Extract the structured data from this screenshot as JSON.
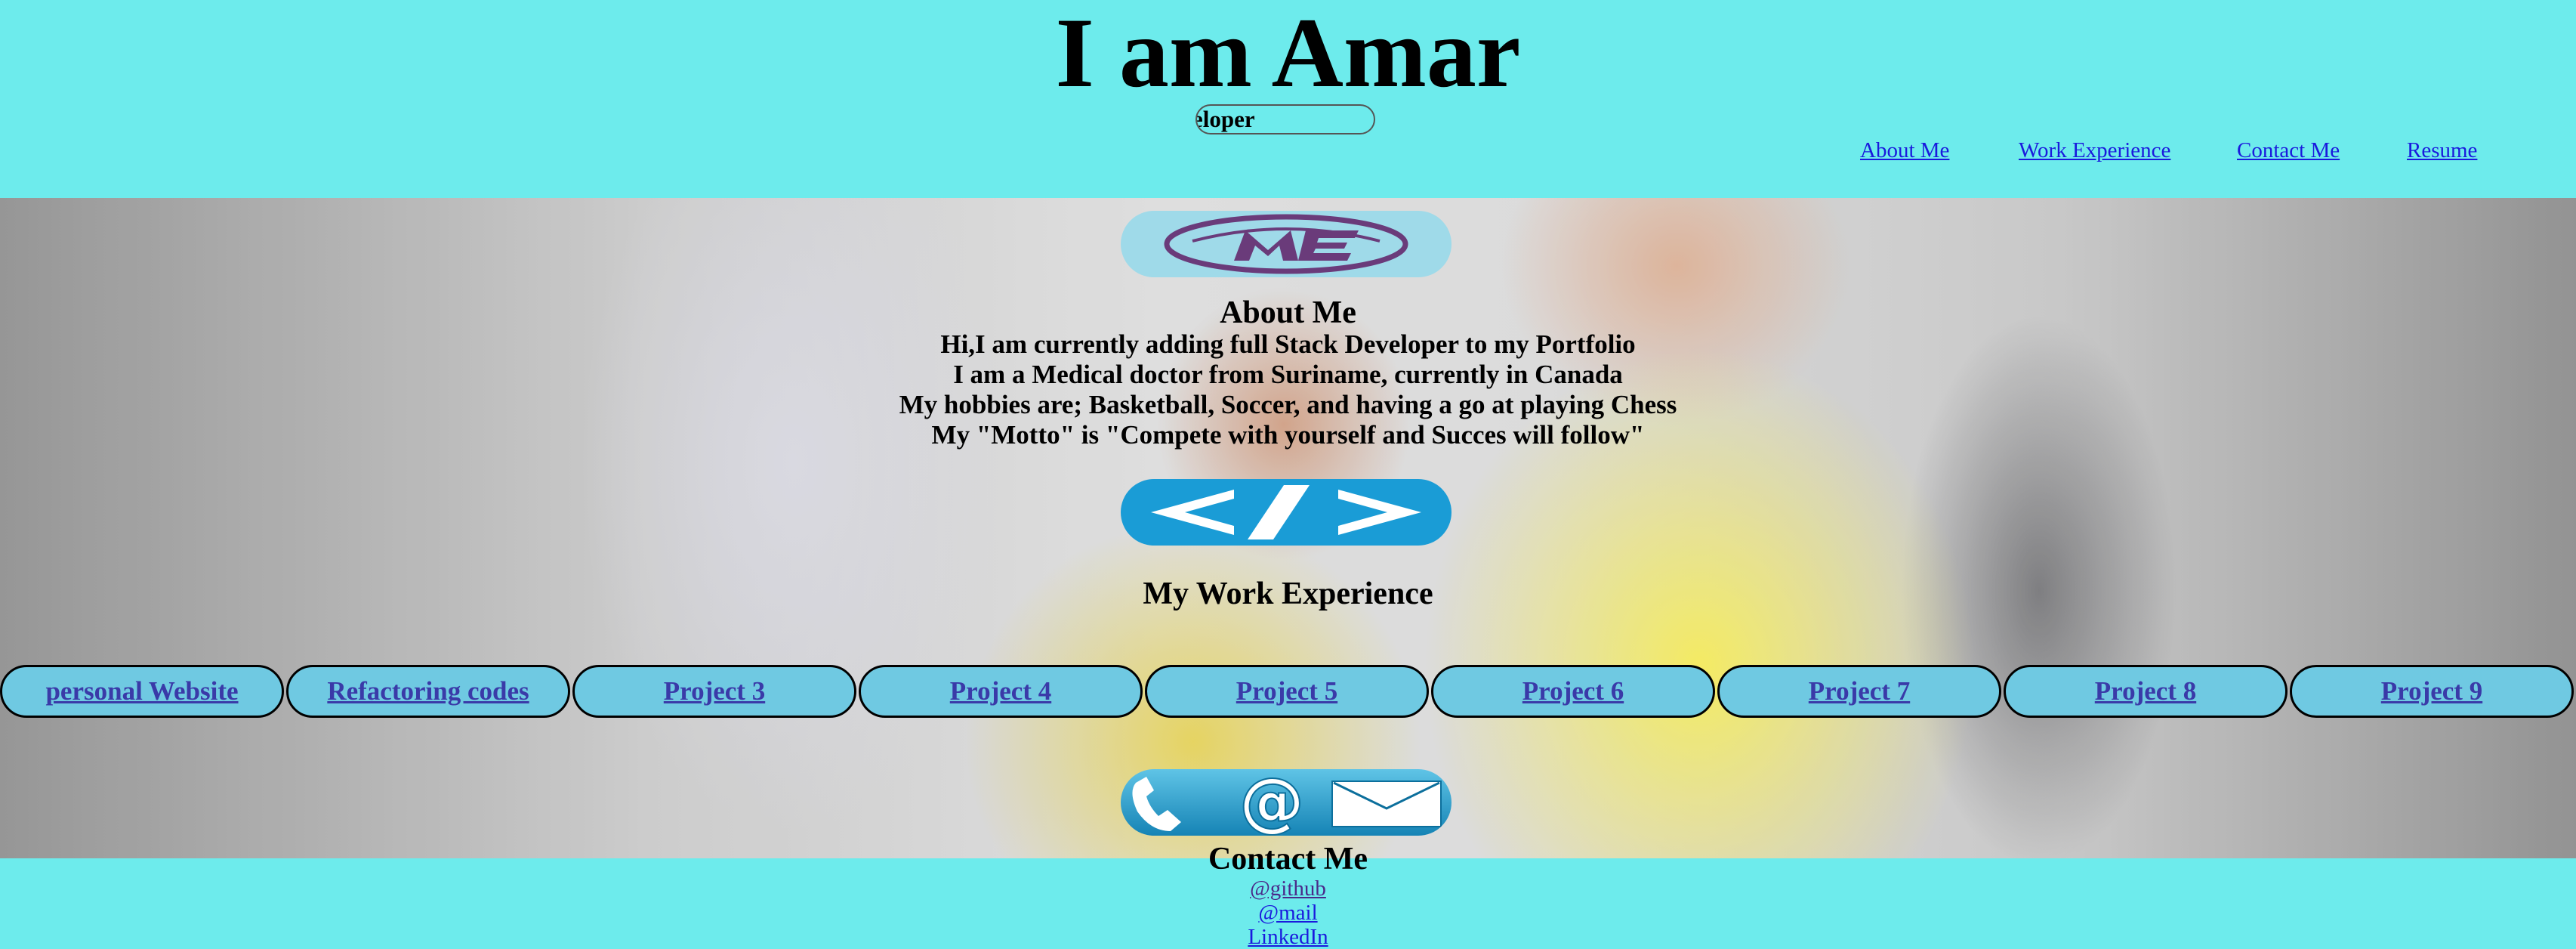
{
  "header": {
    "title": "I am Amar",
    "role_text": "eloper"
  },
  "nav": {
    "items": [
      {
        "label": "About Me"
      },
      {
        "label": "Work Experience"
      },
      {
        "label": "Contact Me"
      },
      {
        "label": "Resume"
      }
    ]
  },
  "about": {
    "badge_icon": "me-logo-icon",
    "title": "About Me",
    "lines": [
      "Hi,I am currently adding full Stack Developer to my Portfolio",
      "I am a Medical doctor from Suriname, currently in Canada",
      "My hobbies are; Basketball, Soccer, and having a go at playing Chess",
      "My \"Motto\" is \"Compete with yourself and Succes will follow\""
    ]
  },
  "work": {
    "badge_icon": "code-brackets-icon",
    "title": "My Work Experience",
    "projects": [
      "personal Website",
      "Refactoring codes",
      "Project 3",
      "Project 4",
      "Project 5",
      "Project 6",
      "Project 7",
      "Project 8",
      "Project 9"
    ]
  },
  "contact": {
    "badge_icon": "phone-at-mail-icon",
    "title": "Contact Me",
    "links": {
      "github": "@github",
      "mail": "@mail",
      "linkedin": "LinkedIn"
    }
  },
  "colors": {
    "header_bg": "#6DEBEC",
    "project_bg": "#6FC9E2",
    "code_badge": "#1A9CD6",
    "me_badge": "#9FDAE9"
  }
}
